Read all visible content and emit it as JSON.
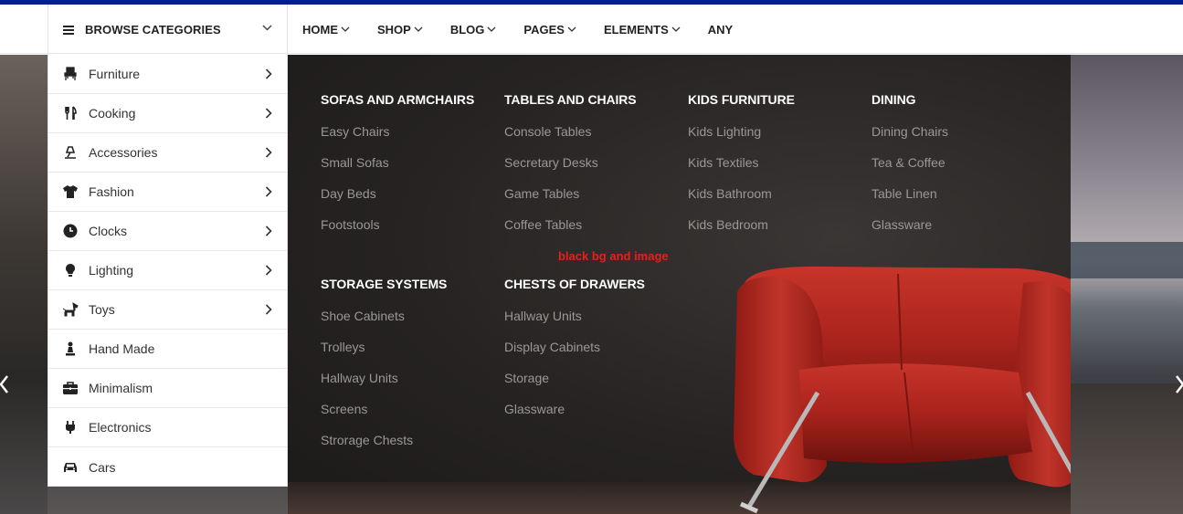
{
  "browse": {
    "label": "BROWSE CATEGORIES"
  },
  "nav": [
    {
      "label": "HOME",
      "dropdown": true
    },
    {
      "label": "SHOP",
      "dropdown": true
    },
    {
      "label": "BLOG",
      "dropdown": true
    },
    {
      "label": "PAGES",
      "dropdown": true
    },
    {
      "label": "ELEMENTS",
      "dropdown": true
    },
    {
      "label": "ANY",
      "dropdown": false
    }
  ],
  "categories": [
    {
      "label": "Furniture",
      "icon": "furniture-icon",
      "has_sub": true
    },
    {
      "label": "Cooking",
      "icon": "cutlery-icon",
      "has_sub": true
    },
    {
      "label": "Accessories",
      "icon": "lamp-icon",
      "has_sub": true
    },
    {
      "label": "Fashion",
      "icon": "tshirt-icon",
      "has_sub": true
    },
    {
      "label": "Clocks",
      "icon": "clock-icon",
      "has_sub": true
    },
    {
      "label": "Lighting",
      "icon": "bulb-icon",
      "has_sub": true
    },
    {
      "label": "Toys",
      "icon": "horse-icon",
      "has_sub": true
    },
    {
      "label": "Hand Made",
      "icon": "chess-icon",
      "has_sub": false
    },
    {
      "label": "Minimalism",
      "icon": "briefcase-icon",
      "has_sub": false
    },
    {
      "label": "Electronics",
      "icon": "plug-icon",
      "has_sub": false
    },
    {
      "label": "Cars",
      "icon": "car-icon",
      "has_sub": false
    }
  ],
  "mega": {
    "columns": [
      {
        "title": "SOFAS AND ARMCHAIRS",
        "links": [
          "Easy Chairs",
          "Small Sofas",
          "Day Beds",
          "Footstools"
        ]
      },
      {
        "title": "TABLES AND CHAIRS",
        "links": [
          "Console Tables",
          "Secretary Desks",
          "Game Tables",
          "Coffee Tables"
        ]
      },
      {
        "title": "KIDS FURNITURE",
        "links": [
          "Kids Lighting",
          "Kids Textiles",
          "Kids Bathroom",
          "Kids Bedroom"
        ]
      },
      {
        "title": "DINING",
        "links": [
          "Dining Chairs",
          "Tea & Coffee",
          "Table Linen",
          "Glassware"
        ]
      },
      {
        "title": "STORAGE SYSTEMS",
        "links": [
          "Shoe Cabinets",
          "Trolleys",
          "Hallway Units",
          "Screens",
          "Strorage Chests"
        ]
      },
      {
        "title": "CHESTS OF DRAWERS",
        "links": [
          "Hallway Units",
          "Display Cabinets",
          "Storage",
          "Glassware"
        ]
      }
    ],
    "note": "black bg and image"
  },
  "colors": {
    "accent_bar": "#001f8f",
    "note": "#e8201a",
    "chair": "#b2241d"
  }
}
